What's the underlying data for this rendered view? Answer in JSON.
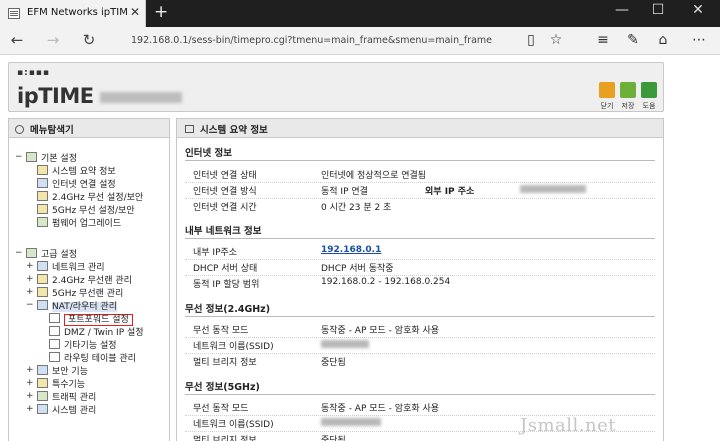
{
  "browser": {
    "tab_title": "EFM Networks ipTIME A",
    "url": "192.168.0.1/sess-bin/timepro.cgi?tmenu=main_frame&smenu=main_frame",
    "new_tab": "+",
    "win_minimize": "—",
    "win_maximize": "☐",
    "win_close": "✕"
  },
  "header": {
    "logo_dots": "▪:▪▪▪",
    "logo": "ipTIME",
    "buttons": [
      {
        "label": "닫기",
        "color": "#e8a020"
      },
      {
        "label": "저장",
        "color": "#6cb03a"
      },
      {
        "label": "도움",
        "color": "#3a9a3a"
      }
    ]
  },
  "sidebar": {
    "title": "메뉴탐색기",
    "basic": {
      "label": "기본 설정",
      "items": [
        "시스템 요약 정보",
        "인터넷 연결 설정",
        "2.4GHz 무선 설정/보안",
        "5GHz 무선 설정/보안",
        "펌웨어 업그레이드"
      ]
    },
    "advanced": {
      "label": "고급 설정",
      "items": [
        "네트워크 관리",
        "2.4GHz 무선랜 관리",
        "5GHz 무선랜 관리",
        "NAT/라우터 관리"
      ],
      "nat_items": [
        "포트포워드 설정",
        "DMZ / Twin IP 설정",
        "기타기능 설정",
        "라우팅 테이블 관리"
      ],
      "more_items": [
        "보안 기능",
        "특수기능",
        "트래픽 관리",
        "시스템 관리"
      ]
    },
    "toggle_minus": "−",
    "toggle_plus": "+"
  },
  "main": {
    "title": "시스템 요약 정보",
    "internet": {
      "heading": "인터넷 정보",
      "rows": [
        {
          "label": "인터넷 연결 상태",
          "value": "인터넷에 정상적으로 연결됨"
        },
        {
          "label": "인터넷 연결 방식",
          "value": "동적 IP 연결",
          "label2": "외부 IP 주소"
        },
        {
          "label": "인터넷 연결 시간",
          "value": "0 시간 23 분 2 초"
        }
      ]
    },
    "internal": {
      "heading": "내부 네트워크 정보",
      "rows": [
        {
          "label": "내부 IP주소",
          "value": "192.168.0.1"
        },
        {
          "label": "DHCP 서버 상태",
          "value": "DHCP 서버 동작중"
        },
        {
          "label": "동적 IP 할당 범위",
          "value": "192.168.0.2 -  192.168.0.254"
        }
      ]
    },
    "wifi24": {
      "heading": "무선 정보(2.4GHz)",
      "rows": [
        {
          "label": "무선 동작 모드",
          "value": "동작중 - AP 모드 - 암호화 사용"
        },
        {
          "label": "네트워크 이름(SSID)",
          "value": ""
        },
        {
          "label": "멀티 브리지 정보",
          "value": "중단됨"
        }
      ]
    },
    "wifi5": {
      "heading": "무선 정보(5GHz)",
      "rows": [
        {
          "label": "무선 동작 모드",
          "value": "동작중 - AP 모드 - 암호화 사용"
        },
        {
          "label": "네트워크 이름(SSID)",
          "value": ""
        },
        {
          "label": "멀티 브리지 정보",
          "value": "중단됨"
        }
      ]
    }
  },
  "watermark": "Jsmall.net"
}
